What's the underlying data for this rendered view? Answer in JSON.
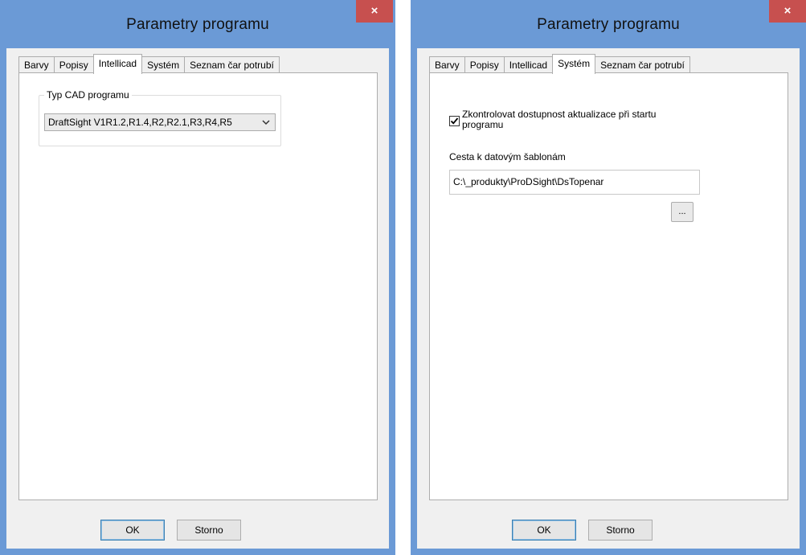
{
  "windows": [
    {
      "title": "Parametry programu",
      "close": "×",
      "tabs": [
        "Barvy",
        "Popisy",
        "Intellicad",
        "Systém",
        "Seznam čar potrubí"
      ],
      "active_tab": "Intellicad",
      "cad_group_label": "Typ CAD programu",
      "cad_select_value": "DraftSight V1R1.2,R1.4,R2,R2.1,R3,R4,R5",
      "ok": "OK",
      "cancel": "Storno"
    },
    {
      "title": "Parametry programu",
      "close": "×",
      "tabs": [
        "Barvy",
        "Popisy",
        "Intellicad",
        "Systém",
        "Seznam čar potrubí"
      ],
      "active_tab": "Systém",
      "update_check_label": "Zkontrolovat dostupnost aktualizace při startu programu",
      "update_check_checked": true,
      "template_path_label": "Cesta k datovým šablonám",
      "template_path_value": "C:\\_produkty\\ProDSight\\DsTopenar",
      "browse": "...",
      "ok": "OK",
      "cancel": "Storno"
    }
  ],
  "colors": {
    "titlebar": "#6b9ad6",
    "close": "#c7504f",
    "client": "#f0f0f0"
  }
}
